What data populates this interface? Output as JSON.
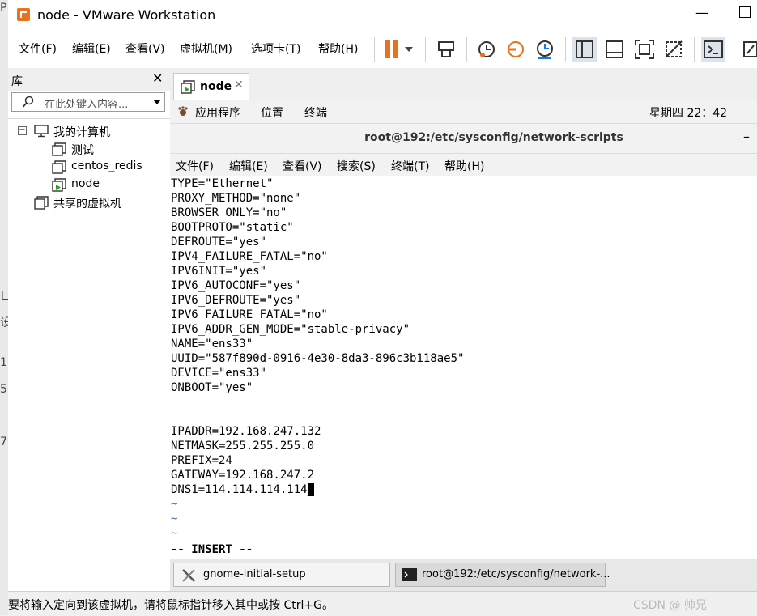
{
  "window": {
    "title": "node - VMware Workstation"
  },
  "menubar": {
    "items": [
      "文件(F)",
      "编辑(E)",
      "查看(V)",
      "虚拟机(M)",
      "选项卡(T)",
      "帮助(H)"
    ]
  },
  "library": {
    "title": "库",
    "search_placeholder": "在此处键入内容...",
    "tree": {
      "root": "我的计算机",
      "vms": [
        "测试",
        "centos_redis",
        "node"
      ],
      "shared": "共享的虚拟机"
    }
  },
  "tabs": [
    {
      "label": "node"
    }
  ],
  "gnome": {
    "applications": "应用程序",
    "places": "位置",
    "terminal": "终端",
    "clock": "星期四 22：42"
  },
  "terminal": {
    "title": "root@192:/etc/sysconfig/network-scripts",
    "menu": [
      "文件(F)",
      "编辑(E)",
      "查看(V)",
      "搜索(S)",
      "终端(T)",
      "帮助(H)"
    ],
    "lines": [
      "TYPE=\"Ethernet\"",
      "PROXY_METHOD=\"none\"",
      "BROWSER_ONLY=\"no\"",
      "BOOTPROTO=\"static\"",
      "DEFROUTE=\"yes\"",
      "IPV4_FAILURE_FATAL=\"no\"",
      "IPV6INIT=\"yes\"",
      "IPV6_AUTOCONF=\"yes\"",
      "IPV6_DEFROUTE=\"yes\"",
      "IPV6_FAILURE_FATAL=\"no\"",
      "IPV6_ADDR_GEN_MODE=\"stable-privacy\"",
      "NAME=\"ens33\"",
      "UUID=\"587f890d-0916-4e30-8da3-896c3b118ae5\"",
      "DEVICE=\"ens33\"",
      "ONBOOT=\"yes\"",
      "",
      "",
      "IPADDR=192.168.247.132",
      "NETMASK=255.255.255.0",
      "PREFIX=24",
      "GATEWAY=192.168.247.2",
      "DNS1=114.114.114.114"
    ],
    "tildes": [
      "~",
      "~",
      "~"
    ],
    "mode": "-- INSERT --"
  },
  "taskbar": {
    "items": [
      "gnome-initial-setup",
      "root@192:/etc/sysconfig/network-..."
    ]
  },
  "status": {
    "text": "要将输入定向到该虚拟机，请将鼠标指针移入其中或按 Ctrl+G。",
    "watermark": "CSDN @ 帅兄"
  },
  "colors": {
    "accent_orange": "#e8731e",
    "tilde_blue": "#3c6ea8"
  }
}
